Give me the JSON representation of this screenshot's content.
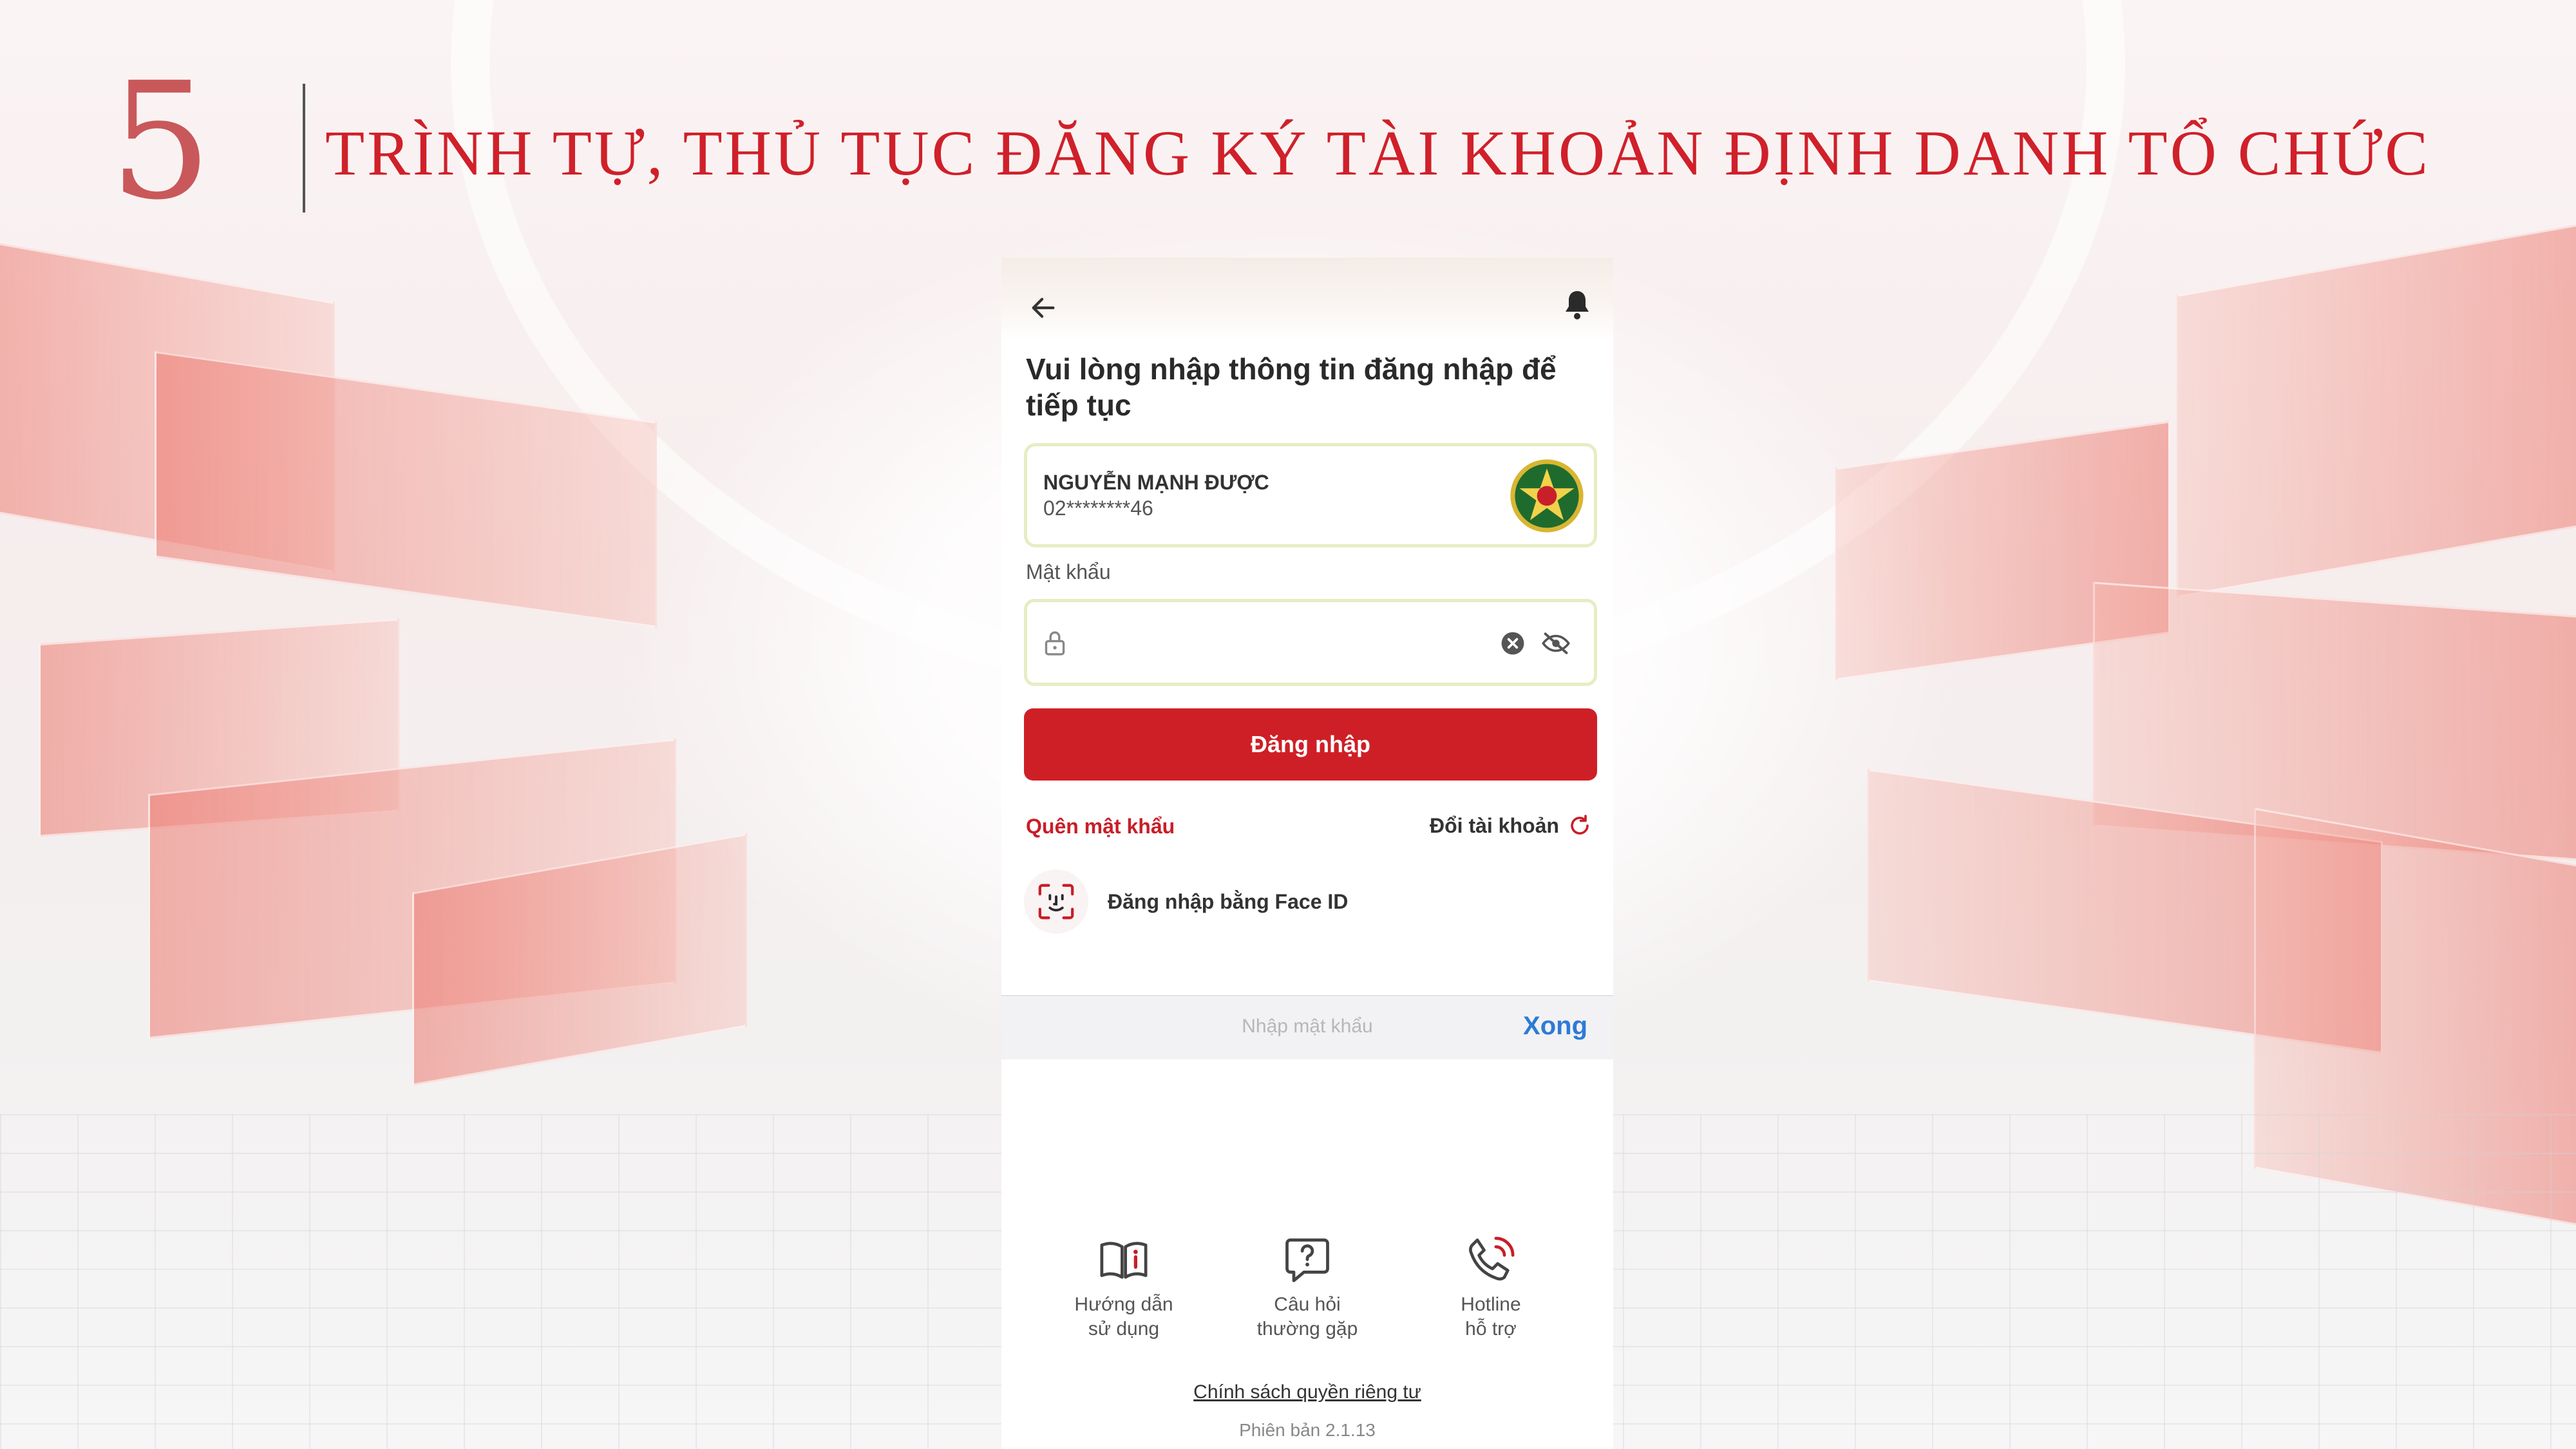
{
  "slide": {
    "number": "5",
    "title": "TRÌNH TỰ, THỦ TỤC ĐĂNG KÝ TÀI KHOẢN ĐỊNH DANH TỔ CHỨC"
  },
  "app": {
    "heading": "Vui lòng nhập thông tin đăng nhập để tiếp tục",
    "account": {
      "name": "NGUYỄN MẠNH ĐƯỢC",
      "id_masked": "02********46"
    },
    "password": {
      "label": "Mật khẩu",
      "value": ""
    },
    "login_button": "Đăng nhập",
    "forgot_password": "Quên mật khẩu",
    "switch_account": "Đổi tài khoản",
    "face_id_login": "Đăng nhập bằng Face ID",
    "keyboard_bar": {
      "placeholder": "Nhập mật khẩu",
      "done": "Xong"
    },
    "bottom_nav": [
      {
        "label": "Hướng dẫn\nsử dụng",
        "icon": "book-info-icon"
      },
      {
        "label": "Câu hỏi\nthường gặp",
        "icon": "question-bubble-icon"
      },
      {
        "label": "Hotline\nhỗ trợ",
        "icon": "phone-call-icon"
      }
    ],
    "privacy_policy": "Chính sách quyền riêng tư",
    "version": "Phiên bản 2.1.13"
  },
  "colors": {
    "brand_red": "#cf1f26",
    "title_red": "#d0202a",
    "number_rose": "#c9585a",
    "done_blue": "#2d7bd6",
    "field_border": "#e8ecc4"
  }
}
